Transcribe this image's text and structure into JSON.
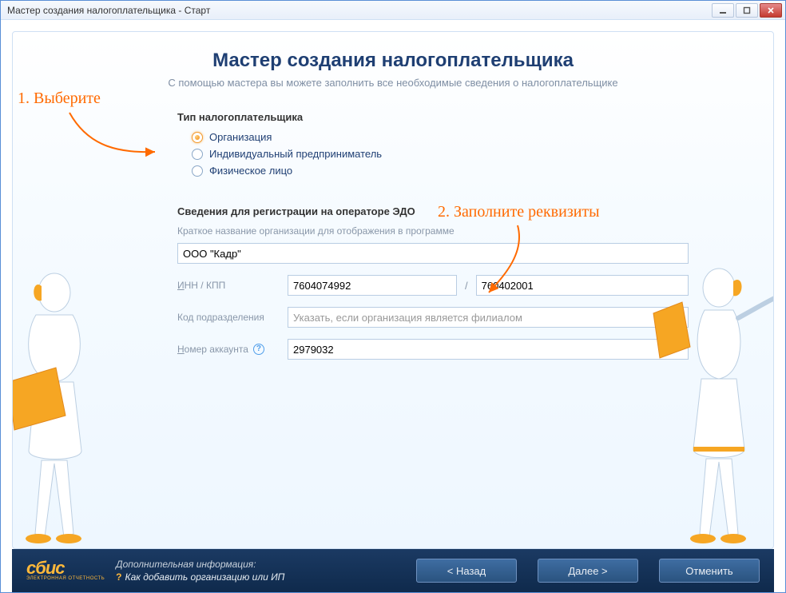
{
  "window": {
    "title": "Мастер создания налогоплательщика - Старт"
  },
  "header": {
    "title": "Мастер создания налогоплательщика",
    "subtitle": "С помощью мастера вы можете заполнить все необходимые сведения о налогоплательщике"
  },
  "annotations": {
    "step1": "1. Выберите",
    "step2": "2. Заполните реквизиты"
  },
  "taxpayer_type": {
    "legend": "Тип налогоплательщика",
    "options": [
      {
        "label": "Организация",
        "checked": true
      },
      {
        "label": "Индивидуальный предприниматель",
        "checked": false
      },
      {
        "label": "Физическое лицо",
        "checked": false
      }
    ]
  },
  "registration": {
    "legend": "Сведения для регистрации на операторе ЭДО",
    "hint": "Краткое название организации для отображения в программе",
    "org_name": "ООО \"Кадр\"",
    "inn_label_u": "И",
    "inn_label_rest": "НН / КПП",
    "inn": "7604074992",
    "slash": "/",
    "kpp": "760402001",
    "dept_label": "Код подразделения",
    "dept_placeholder": "Указать, если организация является филиалом",
    "acct_label_u": "Н",
    "acct_label_rest": "омер аккаунта",
    "acct": "2979032"
  },
  "footer": {
    "logo_main": "сбис",
    "logo_sub": "ЭЛЕКТРОННАЯ ОТЧЕТНОСТЬ",
    "extra_title": "Дополнительная информация:",
    "extra_q": "?",
    "extra_link": "Как добавить организацию или ИП",
    "back": "< Назад",
    "next": "Далее >",
    "cancel": "Отменить"
  }
}
